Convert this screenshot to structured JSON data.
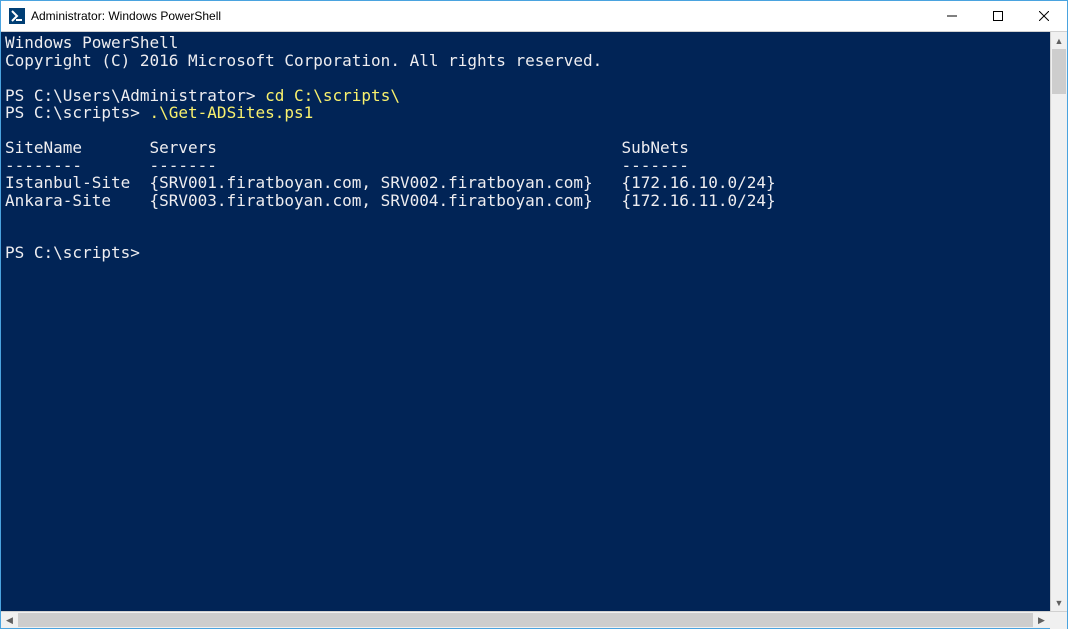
{
  "window": {
    "title": "Administrator: Windows PowerShell"
  },
  "terminal": {
    "line1": "Windows PowerShell",
    "line2": "Copyright (C) 2016 Microsoft Corporation. All rights reserved.",
    "blank1": "",
    "prompt1": "PS C:\\Users\\Administrator> ",
    "cmd1": "cd C:\\scripts\\",
    "prompt2": "PS C:\\scripts> ",
    "cmd2": ".\\Get-ADSites.ps1",
    "blank2": "",
    "header": "SiteName       Servers                                          SubNets",
    "divider": "--------       -------                                          -------",
    "row1": "Istanbul-Site  {SRV001.firatboyan.com, SRV002.firatboyan.com}   {172.16.10.0/24}",
    "row2": "Ankara-Site    {SRV003.firatboyan.com, SRV004.firatboyan.com}   {172.16.11.0/24}",
    "blank3": "",
    "blank4": "",
    "prompt3": "PS C:\\scripts>"
  },
  "table": {
    "columns": [
      "SiteName",
      "Servers",
      "SubNets"
    ],
    "rows": [
      {
        "SiteName": "Istanbul-Site",
        "Servers": "{SRV001.firatboyan.com, SRV002.firatboyan.com}",
        "SubNets": "{172.16.10.0/24}"
      },
      {
        "SiteName": "Ankara-Site",
        "Servers": "{SRV003.firatboyan.com, SRV004.firatboyan.com}",
        "SubNets": "{172.16.11.0/24}"
      }
    ]
  }
}
